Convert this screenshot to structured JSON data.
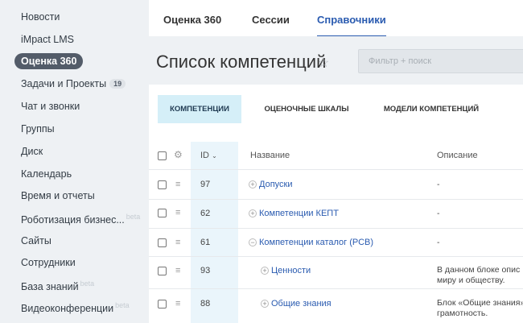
{
  "sidebar": {
    "items": [
      {
        "label": "Новости"
      },
      {
        "label": "iMpact LMS"
      },
      {
        "label": "Оценка 360"
      },
      {
        "label": "Задачи и Проекты",
        "badge": "19"
      },
      {
        "label": "Чат и звонки"
      },
      {
        "label": "Группы"
      },
      {
        "label": "Диск"
      },
      {
        "label": "Календарь"
      },
      {
        "label": "Время и отчеты"
      },
      {
        "label": "Роботизация бизнес...",
        "tag": "beta"
      },
      {
        "label": "Сайты"
      },
      {
        "label": "Сотрудники"
      },
      {
        "label": "База знаний",
        "tag": "beta"
      },
      {
        "label": "Видеоконференции",
        "tag": "beta"
      }
    ]
  },
  "tabs": [
    {
      "label": "Оценка 360"
    },
    {
      "label": "Сессии"
    },
    {
      "label": "Справочники"
    }
  ],
  "page": {
    "title": "Список компетенций",
    "filter_placeholder": "Фильтр + поиск"
  },
  "subtabs": [
    {
      "label": "КОМПЕТЕНЦИИ"
    },
    {
      "label": "ОЦЕНОЧНЫЕ ШКАЛЫ"
    },
    {
      "label": "МОДЕЛИ КОМПЕТЕНЦИЙ"
    }
  ],
  "table": {
    "headers": {
      "id": "ID",
      "name": "Название",
      "desc": "Описание"
    },
    "rows": [
      {
        "id": "97",
        "toggle": "+",
        "name": "Допуски",
        "desc": "-"
      },
      {
        "id": "62",
        "toggle": "+",
        "name": "Компетенции КЕПТ",
        "desc": "-"
      },
      {
        "id": "61",
        "toggle": "−",
        "name": "Компетенции каталог (РСВ)",
        "desc": "-"
      },
      {
        "id": "93",
        "toggle": "+",
        "name": "Ценности",
        "desc": "В данном блоке опис",
        "desc2": "миру и обществу."
      },
      {
        "id": "88",
        "toggle": "+",
        "name": "Общие знания",
        "desc": "Блок «Общие знания»",
        "desc2": "грамотность."
      }
    ]
  },
  "colors": {
    "accent": "#2a5bb0",
    "active_subtab": "#d5eff8",
    "sidebar_active": "#535c69"
  }
}
